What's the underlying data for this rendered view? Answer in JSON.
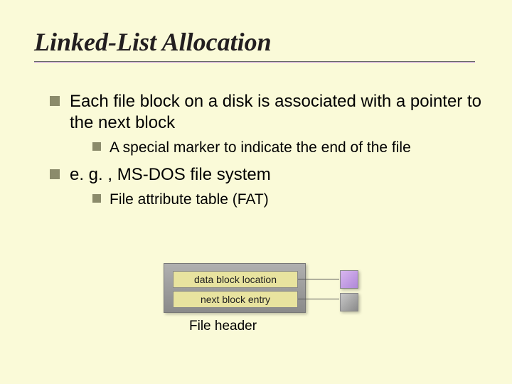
{
  "title": "Linked-List Allocation",
  "bullets": {
    "b1": "Each file block on a disk is associated with a pointer to the next block",
    "b1s1": "A special marker to indicate the end of the file",
    "b2": "e. g. , MS-DOS file system",
    "b2s1": "File attribute table (FAT)"
  },
  "diagram": {
    "field1": "data block location",
    "field2": "next block entry",
    "caption": "File header"
  }
}
